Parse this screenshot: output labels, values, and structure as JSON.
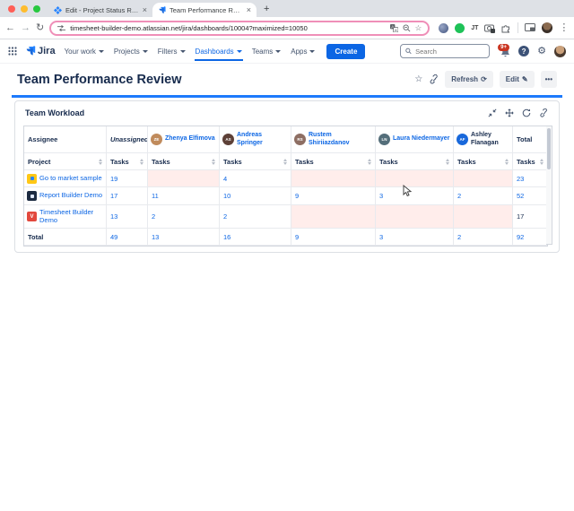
{
  "browser": {
    "tabs": [
      {
        "title": "Edit - Project Status Report"
      },
      {
        "title": "Team Performance Review -"
      }
    ],
    "new_tab_glyph": "+",
    "close_glyph": "×",
    "back_glyph": "←",
    "forward_glyph": "→",
    "reload_glyph": "↻",
    "url": "timesheet-builder-demo.atlassian.net/jira/dashboards/10004?maximized=10050",
    "star_glyph": "☆",
    "ext_jt_label": "JT",
    "menu_glyph": "⋮"
  },
  "nav": {
    "logo": "Jira",
    "items": [
      {
        "label": "Your work"
      },
      {
        "label": "Projects"
      },
      {
        "label": "Filters"
      },
      {
        "label": "Dashboards"
      },
      {
        "label": "Teams"
      },
      {
        "label": "Apps"
      }
    ],
    "create_label": "Create",
    "search_placeholder": "Search",
    "notification_badge": "9+",
    "help_glyph": "?",
    "gear_glyph": "⚙"
  },
  "page": {
    "title": "Team Performance Review",
    "star_glyph": "☆",
    "refresh_label": "Refresh",
    "refresh_glyph": "⟳",
    "edit_label": "Edit",
    "edit_glyph": "✎",
    "more_glyph": "•••"
  },
  "widget": {
    "title": "Team Workload",
    "table": {
      "assignee_header": "Assignee",
      "project_header": "Project",
      "tasks_label": "Tasks",
      "total_header": "Total",
      "assignees": [
        {
          "name": "Unassigned"
        },
        {
          "name": "Zhenya Elfimova",
          "initials": "ZE",
          "color": "#c08b5c"
        },
        {
          "name": "Andreas Springer",
          "initials": "AS",
          "color": "#5d4037"
        },
        {
          "name": "Rustem Shiriiazdanov",
          "initials": "RS",
          "color": "#8d6e63"
        },
        {
          "name": "Laura Niedermayer",
          "initials": "LN",
          "color": "#546e7a"
        },
        {
          "name": "Ashley Flanagan",
          "initials": "AF",
          "color": "#1868db"
        }
      ],
      "rows": [
        {
          "project": "Go to market sample",
          "icon_color": "#ffc716",
          "values": [
            "19",
            "",
            "4",
            "",
            "",
            ""
          ],
          "total": "23"
        },
        {
          "project": "Report Builder Demo",
          "icon_color": "#1c2b41",
          "values": [
            "17",
            "11",
            "10",
            "9",
            "3",
            "2"
          ],
          "total": "52"
        },
        {
          "project": "Timesheet Builder Demo",
          "icon_color": "#e2483d",
          "values": [
            "13",
            "2",
            "2",
            "",
            "",
            ""
          ],
          "total": "17"
        }
      ],
      "total_row": {
        "label": "Total",
        "values": [
          "49",
          "13",
          "16",
          "9",
          "3",
          "2"
        ],
        "total": "92"
      }
    }
  },
  "colors": {
    "accent_blue": "#0c66e4",
    "blue_line": "#1d7afc",
    "empty_cell_pink": "#ffedeb",
    "badge_red": "#ca3521",
    "tabstrip_gray": "#dee1e6",
    "urlbar_ring_pink": "#ef8fb8"
  }
}
